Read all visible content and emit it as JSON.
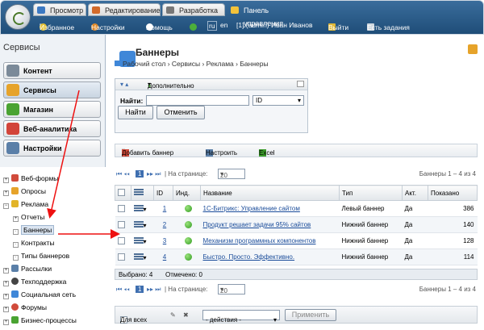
{
  "tabs": [
    "Просмотр",
    "Редактирование",
    "Разработка",
    "Панель управления"
  ],
  "nav": {
    "favorites": "Избранное",
    "settings": "Настройки",
    "help": "Помощь",
    "lang_ru": "ru",
    "lang_en": "en",
    "user": "[1] (admin) Иван Иванов",
    "logout": "Выйти",
    "tasks": "Есть задания"
  },
  "sidebar": {
    "title": "Сервисы",
    "buttons": [
      "Контент",
      "Сервисы",
      "Магазин",
      "Веб-аналитика",
      "Настройки"
    ]
  },
  "tree": [
    "Веб-формы",
    "Опросы",
    "Реклама",
    "Отчеты",
    "Баннеры",
    "Контракты",
    "Типы баннеров",
    "Рассылки",
    "Техподдержка",
    "Социальная сеть",
    "Форумы",
    "Бизнес-процессы"
  ],
  "page": {
    "title": "Баннеры",
    "breadcrumb": "Рабочий стол › Сервисы › Реклама › Баннеры"
  },
  "filter": {
    "more": "Дополнительно",
    "name_label": "Найти:",
    "field": "ID",
    "find_btn": "Найти",
    "cancel_btn": "Отменить"
  },
  "toolbar": {
    "add": "Добавить баннер",
    "configure": "Настроить",
    "excel": "Excel"
  },
  "pager": {
    "page": "1",
    "per_page_label": "| На странице:",
    "per_page": "20",
    "summary": "Баннеры 1 – 4 из 4"
  },
  "table": {
    "headers": [
      "ID",
      "Инд.",
      "Название",
      "Тип",
      "Акт.",
      "Показано"
    ],
    "rows": [
      {
        "id": "1",
        "name": "1С-Битрикс: Управление сайтом",
        "type": "Левый баннер",
        "active": "Да",
        "shown": "386"
      },
      {
        "id": "2",
        "name": "Продукт решает задачи 95% сайтов",
        "type": "Нижний баннер",
        "active": "Да",
        "shown": "140"
      },
      {
        "id": "3",
        "name": "Механизм программных компонентов",
        "type": "Нижний баннер",
        "active": "Да",
        "shown": "128"
      },
      {
        "id": "4",
        "name": "Быстро. Просто. Эффективно.",
        "type": "Нижний баннер",
        "active": "Да",
        "shown": "114"
      }
    ],
    "selected": "Выбрано: 4",
    "marked": "Отмечено: 0"
  },
  "actions": {
    "all": "Для всех",
    "select": "- действия -",
    "apply": "Применить"
  }
}
